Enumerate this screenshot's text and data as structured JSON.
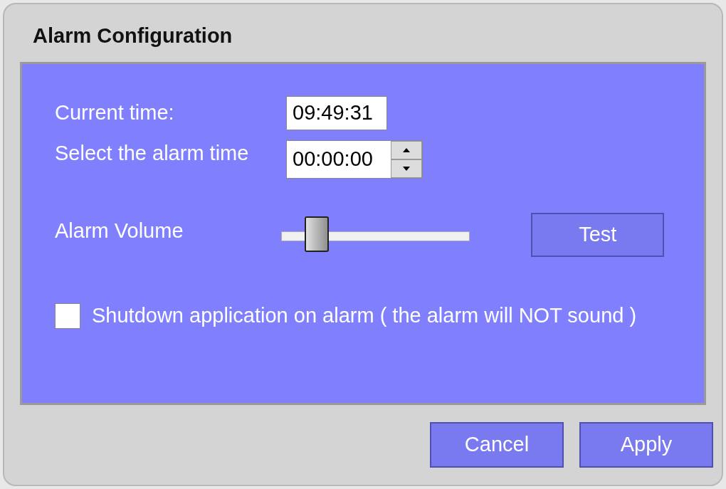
{
  "window": {
    "title": "Alarm Configuration"
  },
  "current_time": {
    "label": "Current time:",
    "value": "09:49:31"
  },
  "alarm_time": {
    "label": "Select the alarm time",
    "value": "00:00:00"
  },
  "volume": {
    "label": "Alarm Volume",
    "level": 0.19
  },
  "test_button": "Test",
  "shutdown": {
    "label": "Shutdown application on alarm ( the alarm will NOT sound )",
    "checked": false
  },
  "buttons": [
    "Cancel",
    "Apply"
  ]
}
